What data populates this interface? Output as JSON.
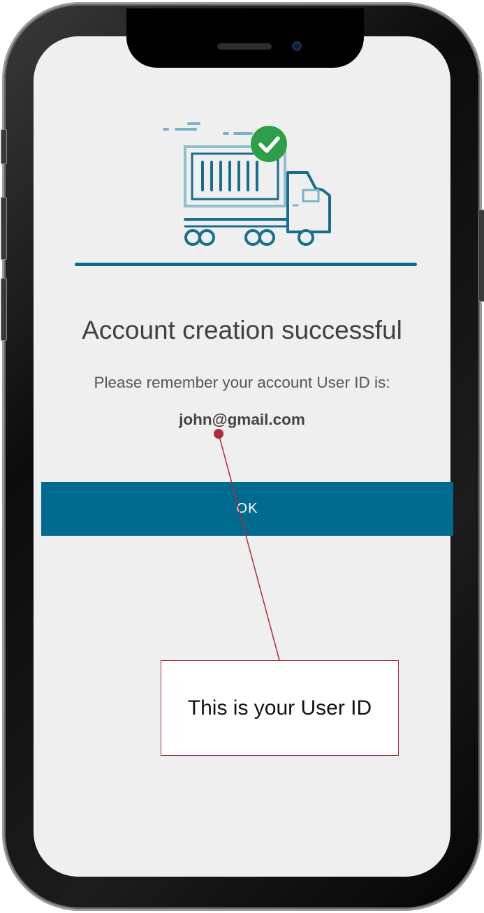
{
  "screen": {
    "title": "Account creation successful",
    "message": "Please remember your account User ID is:",
    "user_id": "john@gmail.com",
    "ok_label": "OK"
  },
  "callout": {
    "text": "This is your User ID"
  },
  "icons": {
    "illustration": "truck-icon",
    "status": "check-circle-icon"
  },
  "colors": {
    "primary": "#006b8f",
    "success": "#2e9e48",
    "annotation": "#b02c3c",
    "background": "#efefef"
  }
}
